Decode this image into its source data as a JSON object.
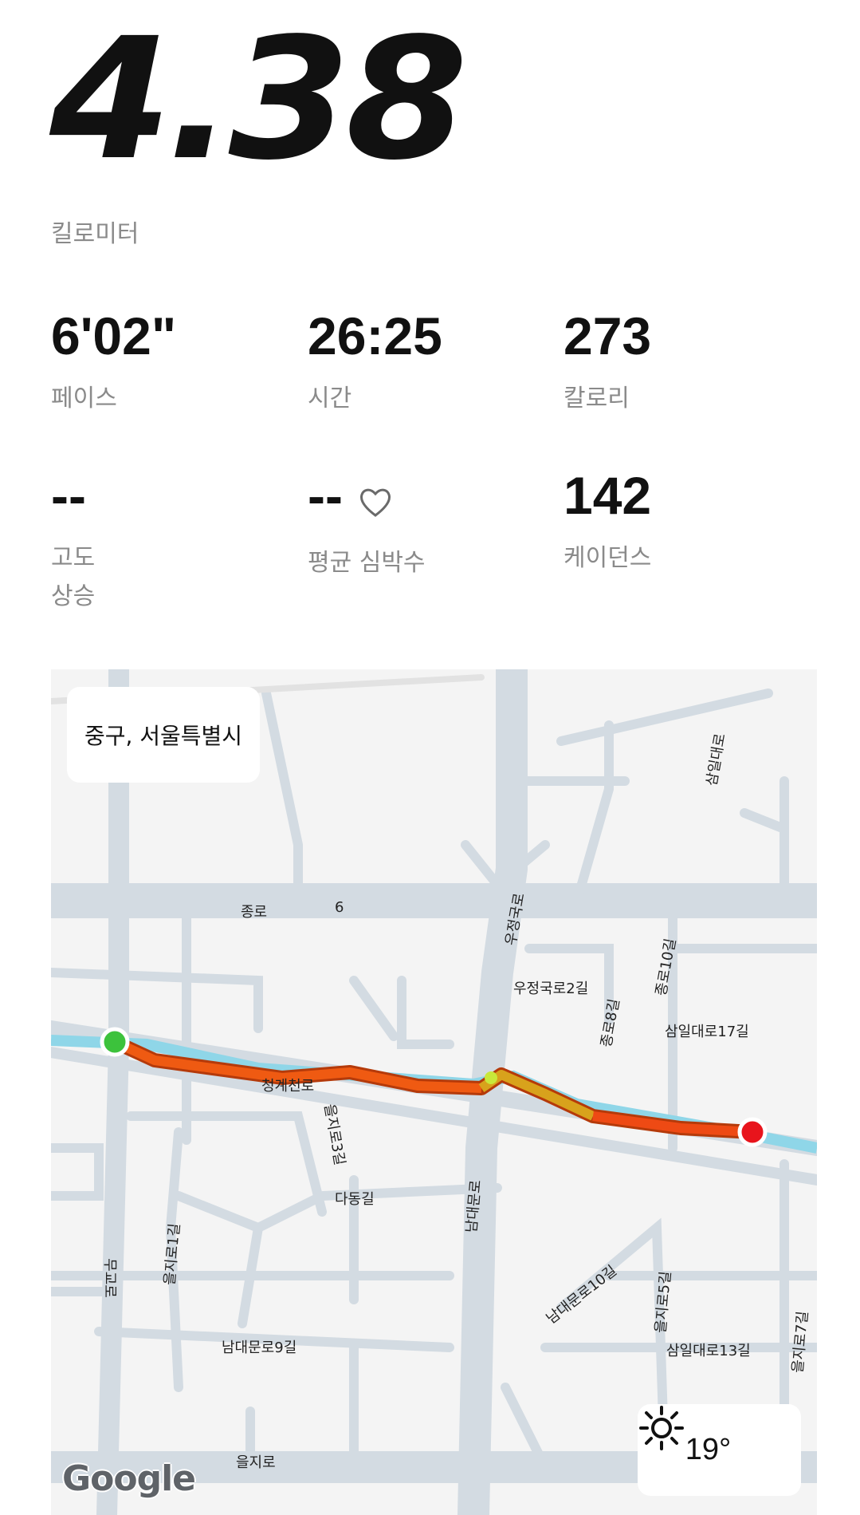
{
  "distance": {
    "value": "4.38",
    "unit": "킬로미터"
  },
  "stats": [
    {
      "value": "6'02\"",
      "label": "페이스"
    },
    {
      "value": "26:25",
      "label": "시간"
    },
    {
      "value": "273",
      "label": "칼로리"
    },
    {
      "value": "--",
      "label": "고도\n상승"
    },
    {
      "value": "--",
      "label": "평균 심박수"
    },
    {
      "value": "142",
      "label": "케이던스"
    }
  ],
  "map": {
    "location": "중구, 서울특별시",
    "attribution": "Google",
    "weather": {
      "temperature": "19°",
      "icon": "sun-icon"
    },
    "streets": [
      "종로",
      "6",
      "우정국로",
      "우정국로2길",
      "종로10길",
      "종로8길",
      "삼일대로17길",
      "청계천로",
      "을지로3길",
      "다동길",
      "을지로1길",
      "남대문로",
      "남대문로10길",
      "을지로5길",
      "삼일대로13길",
      "을지로7길",
      "남대문로9길",
      "을지로",
      "무교로",
      "삼일대로"
    ],
    "route_colors": {
      "start": "#3cc23c",
      "end": "#e8141c",
      "mid": "#ef5a12",
      "fast": "#c8c820"
    }
  }
}
